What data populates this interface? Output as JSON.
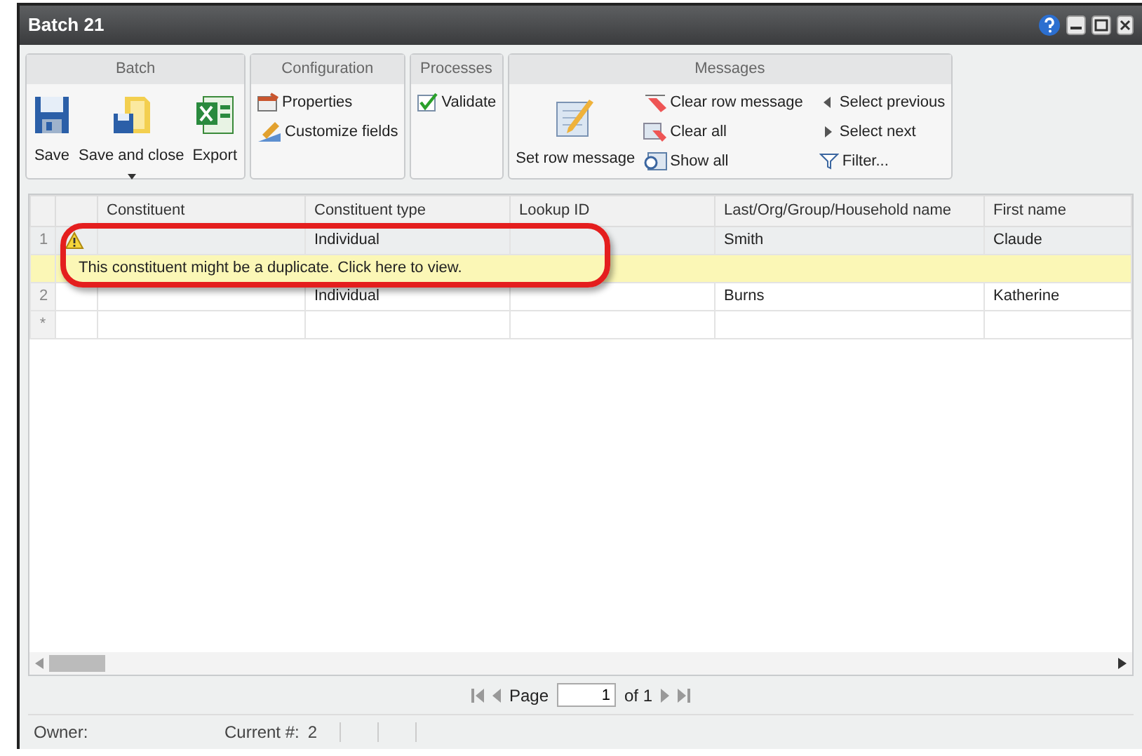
{
  "window": {
    "title": "Batch 21"
  },
  "ribbon": [
    {
      "title": "Batch",
      "items": [
        {
          "kind": "large",
          "label": "Save",
          "dropdown": false
        },
        {
          "kind": "large",
          "label": "Save and close",
          "dropdown": true
        },
        {
          "kind": "large",
          "label": "Export",
          "dropdown": false
        }
      ]
    },
    {
      "title": "Configuration",
      "items": [
        {
          "kind": "small",
          "label": "Properties"
        },
        {
          "kind": "small",
          "label": "Customize fields"
        }
      ]
    },
    {
      "title": "Processes",
      "items": [
        {
          "kind": "small",
          "label": "Validate"
        }
      ]
    },
    {
      "title": "Messages",
      "items": [
        {
          "kind": "large",
          "label": "Set row message",
          "dropdown": false
        },
        {
          "kind": "small",
          "label": "Clear row message"
        },
        {
          "kind": "small",
          "label": "Clear all"
        },
        {
          "kind": "small",
          "label": "Show all"
        },
        {
          "kind": "small",
          "label": "Select previous"
        },
        {
          "kind": "small",
          "label": "Select next"
        },
        {
          "kind": "small",
          "label": "Filter..."
        }
      ]
    }
  ],
  "grid": {
    "columns": [
      "Constituent",
      "Constituent type",
      "Lookup ID",
      "Last/Org/Group/Household name",
      "First name"
    ],
    "rows": [
      {
        "number": "1",
        "selected": true,
        "warning": true,
        "cells": [
          "",
          "Individual",
          "",
          "Smith",
          "Claude"
        ],
        "message": "This constituent might be a duplicate. Click here to view."
      },
      {
        "number": "2",
        "selected": false,
        "warning": false,
        "cells": [
          "",
          "Individual",
          "",
          "Burns",
          "Katherine"
        ]
      }
    ],
    "new_row_marker": "*"
  },
  "pager": {
    "page_label": "Page",
    "page_value": "1",
    "of_label": "of 1"
  },
  "status_bar": {
    "owner_label": "Owner:",
    "current_label": "Current #:",
    "current_value": "2"
  }
}
